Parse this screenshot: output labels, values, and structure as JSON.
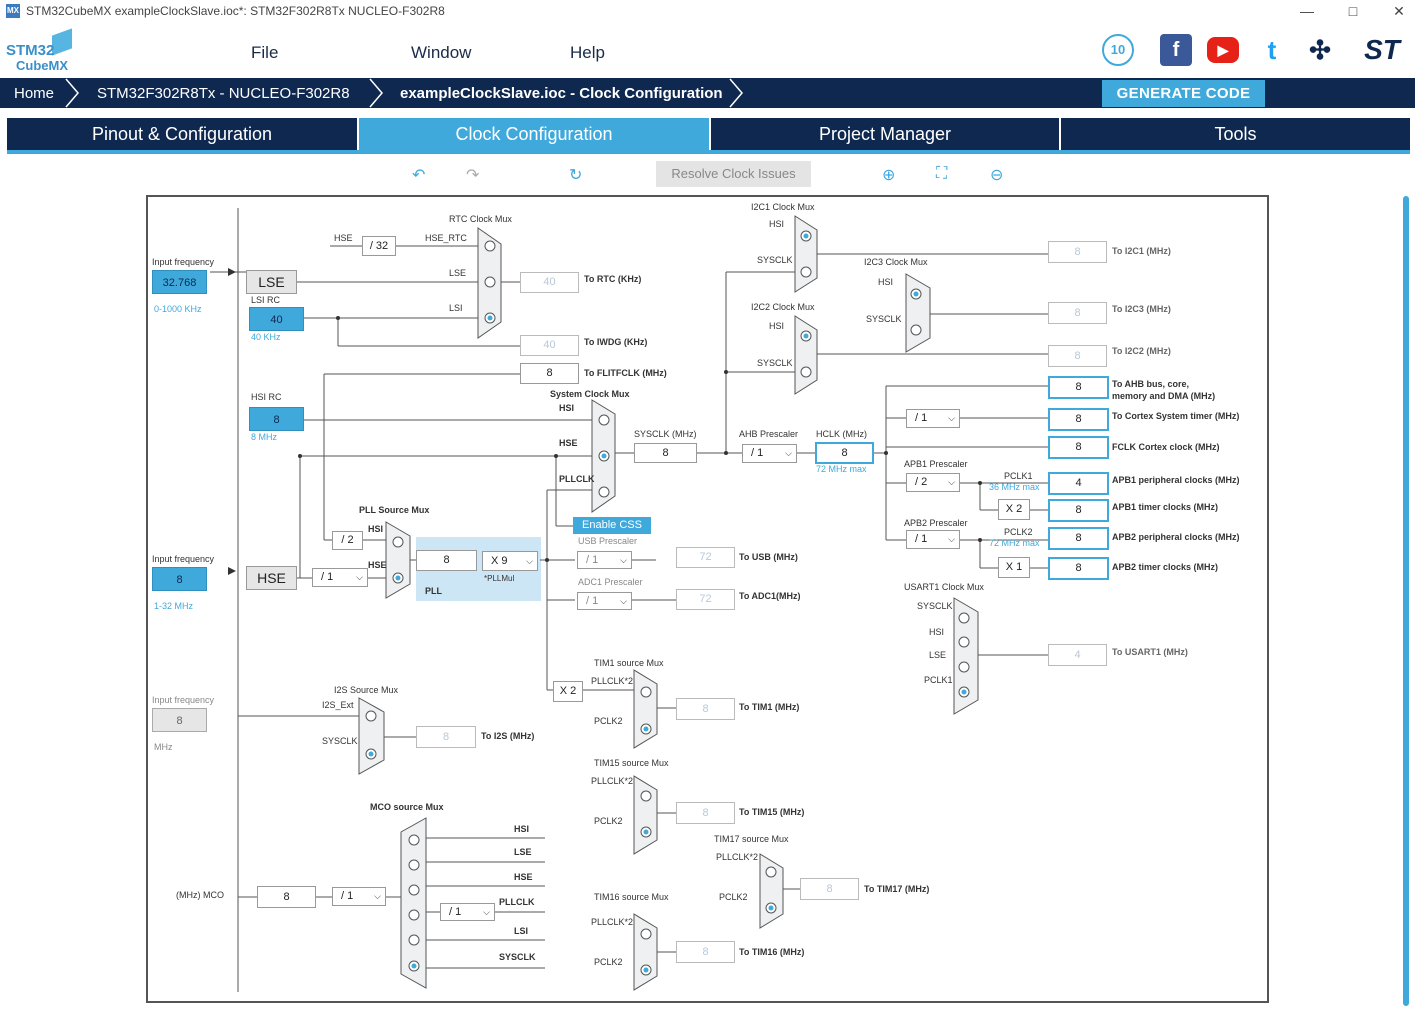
{
  "window": {
    "app_icon": "MX",
    "title": "STM32CubeMX exampleClockSlave.ioc*: STM32F302R8Tx NUCLEO-F302R8",
    "minimize_icon": "minimize-icon",
    "maximize_icon": "maximize-icon",
    "close_icon": "close-icon"
  },
  "logo": {
    "line1": "STM32",
    "line2": "CubeMX"
  },
  "menu": {
    "file": "File",
    "window": "Window",
    "help": "Help"
  },
  "social": {
    "anniversary": "10",
    "facebook": "f",
    "youtube": "▶",
    "twitter": "t",
    "network": "✣",
    "st": "ST"
  },
  "breadcrumb": {
    "home": "Home",
    "device": "STM32F302R8Tx  -  NUCLEO-F302R8",
    "project": "exampleClockSlave.ioc - Clock Configuration"
  },
  "generate_label": "GENERATE CODE",
  "tabs": {
    "pinout": "Pinout & Configuration",
    "clock": "Clock Configuration",
    "project": "Project Manager",
    "tools": "Tools"
  },
  "toolbar": {
    "undo": "↶",
    "redo": "↷",
    "refresh": "↻",
    "resolve": "Resolve Clock Issues",
    "zoom_in": "⊕",
    "fit": "⛶",
    "zoom_out": "⊖"
  },
  "clock": {
    "lse_input_label": "Input frequency",
    "lse_value": "32.768",
    "lse_range": "0-1000 KHz",
    "lse": "LSE",
    "lsi_rc_label": "LSI RC",
    "lsi_value": "40",
    "lsi_unit": "40 KHz",
    "hsi_rc_label": "HSI RC",
    "hsi_value": "8",
    "hsi_unit": "8 MHz",
    "hse_input_label": "Input frequency",
    "hse_value": "8",
    "hse_range": "1-32 MHz",
    "hse": "HSE",
    "i2s_input_label": "Input frequency",
    "i2s_value": "8",
    "i2s_unit": "MHz",
    "rtc_mux": "RTC Clock Mux",
    "rtc_hse": "HSE",
    "rtc_div": "/ 32",
    "rtc_hse_rtc": "HSE_RTC",
    "rtc_lse": "LSE",
    "rtc_lsi": "LSI",
    "rtc_out": "40",
    "rtc_to": "To RTC (KHz)",
    "iwdg_out": "40",
    "iwdg_to": "To IWDG (KHz)",
    "flit_out": "8",
    "flit_to": "To FLITFCLK (MHz)",
    "sys_mux": "System Clock Mux",
    "sys_hsi": "HSI",
    "sys_hse": "HSE",
    "sys_pll": "PLLCLK",
    "sysclk_label": "SYSCLK (MHz)",
    "sysclk": "8",
    "ahb_label": "AHB Prescaler",
    "ahb": "/ 1",
    "hclk_label": "HCLK (MHz)",
    "hclk": "8",
    "hclk_max": "72 MHz max",
    "css": "Enable CSS",
    "pll_src_mux": "PLL Source Mux",
    "pll_hsi": "HSI",
    "pll_hse": "HSE",
    "pll_hsi_div": "/ 2",
    "hse_prediv": "/ 1",
    "pll_in": "8",
    "pll_mul": "X 9",
    "pll_mul_label": "*PLLMul",
    "pll_label": "PLL",
    "usb_prescaler": "USB Prescaler",
    "usb": "/ 1",
    "usb_out": "72",
    "usb_to": "To USB (MHz)",
    "adc_prescaler": "ADC1 Prescaler",
    "adc": "/ 1",
    "adc_out": "72",
    "adc_to": "To ADC1(MHz)",
    "i2c1_mux": "I2C1 Clock Mux",
    "i2c1_hsi": "HSI",
    "i2c1_sys": "SYSCLK",
    "i2c1_out": "8",
    "i2c1_to": "To I2C1 (MHz)",
    "i2c3_mux": "I2C3 Clock Mux",
    "i2c3_hsi": "HSI",
    "i2c3_sys": "SYSCLK",
    "i2c3_out": "8",
    "i2c3_to": "To I2C3 (MHz)",
    "i2c2_mux": "I2C2 Clock Mux",
    "i2c2_hsi": "HSI",
    "i2c2_sys": "SYSCLK",
    "i2c2_out": "8",
    "i2c2_to": "To I2C2 (MHz)",
    "ahb_out": "8",
    "ahb_to1": "To AHB bus, core,",
    "ahb_to2": "memory and DMA (MHz)",
    "cortex_div": "/ 1",
    "cortex_out": "8",
    "cortex_to": "To Cortex System timer (MHz)",
    "fclk_out": "8",
    "fclk_to": "FCLK Cortex clock (MHz)",
    "apb1_label": "APB1 Prescaler",
    "apb1": "/ 2",
    "pclk1": "PCLK1",
    "pclk1_max": "36 MHz max",
    "apb1_periph": "4",
    "apb1_periph_to": "APB1 peripheral clocks (MHz)",
    "apb1_x2": "X 2",
    "apb1_timer": "8",
    "apb1_timer_to": "APB1 timer clocks (MHz)",
    "apb2_label": "APB2 Prescaler",
    "apb2": "/ 1",
    "pclk2": "PCLK2",
    "pclk2_max": "72 MHz max",
    "apb2_periph": "8",
    "apb2_periph_to": "APB2 peripheral clocks (MHz)",
    "apb2_x1": "X 1",
    "apb2_timer": "8",
    "apb2_timer_to": "APB2 timer clocks (MHz)",
    "usart_mux": "USART1 Clock Mux",
    "usart_sys": "SYSCLK",
    "usart_hsi": "HSI",
    "usart_lse": "LSE",
    "usart_pclk": "PCLK1",
    "usart_out": "4",
    "usart_to": "To USART1 (MHz)",
    "tim1_mux": "TIM1 source Mux",
    "tim1_pll": "PLLCLK*2",
    "tim1_pclk": "PCLK2",
    "tim1_x2": "X 2",
    "tim1_out": "8",
    "tim1_to": "To TIM1 (MHz)",
    "tim15_mux": "TIM15 source Mux",
    "tim15_pll": "PLLCLK*2",
    "tim15_pclk": "PCLK2",
    "tim15_out": "8",
    "tim15_to": "To TIM15 (MHz)",
    "tim17_mux": "TIM17 source Mux",
    "tim17_pll": "PLLCLK*2",
    "tim17_pclk": "PCLK2",
    "tim17_out": "8",
    "tim17_to": "To TIM17 (MHz)",
    "tim16_mux": "TIM16 source Mux",
    "tim16_pll": "PLLCLK*2",
    "tim16_pclk": "PCLK2",
    "tim16_out": "8",
    "tim16_to": "To TIM16 (MHz)",
    "i2s_mux": "I2S Source Mux",
    "i2s_ext": "I2S_Ext",
    "i2s_sys": "SYSCLK",
    "i2s_out": "8",
    "i2s_to": "To I2S (MHz)",
    "mco_mux": "MCO source Mux",
    "mco_hsi": "HSI",
    "mco_lse": "LSE",
    "mco_hse": "HSE",
    "mco_pll": "PLLCLK",
    "mco_lsi": "LSI",
    "mco_sys": "SYSCLK",
    "mco_pll_div": "/ 1",
    "mco_div": "/ 1",
    "mco_out": "8",
    "mco_label": "(MHz) MCO"
  }
}
